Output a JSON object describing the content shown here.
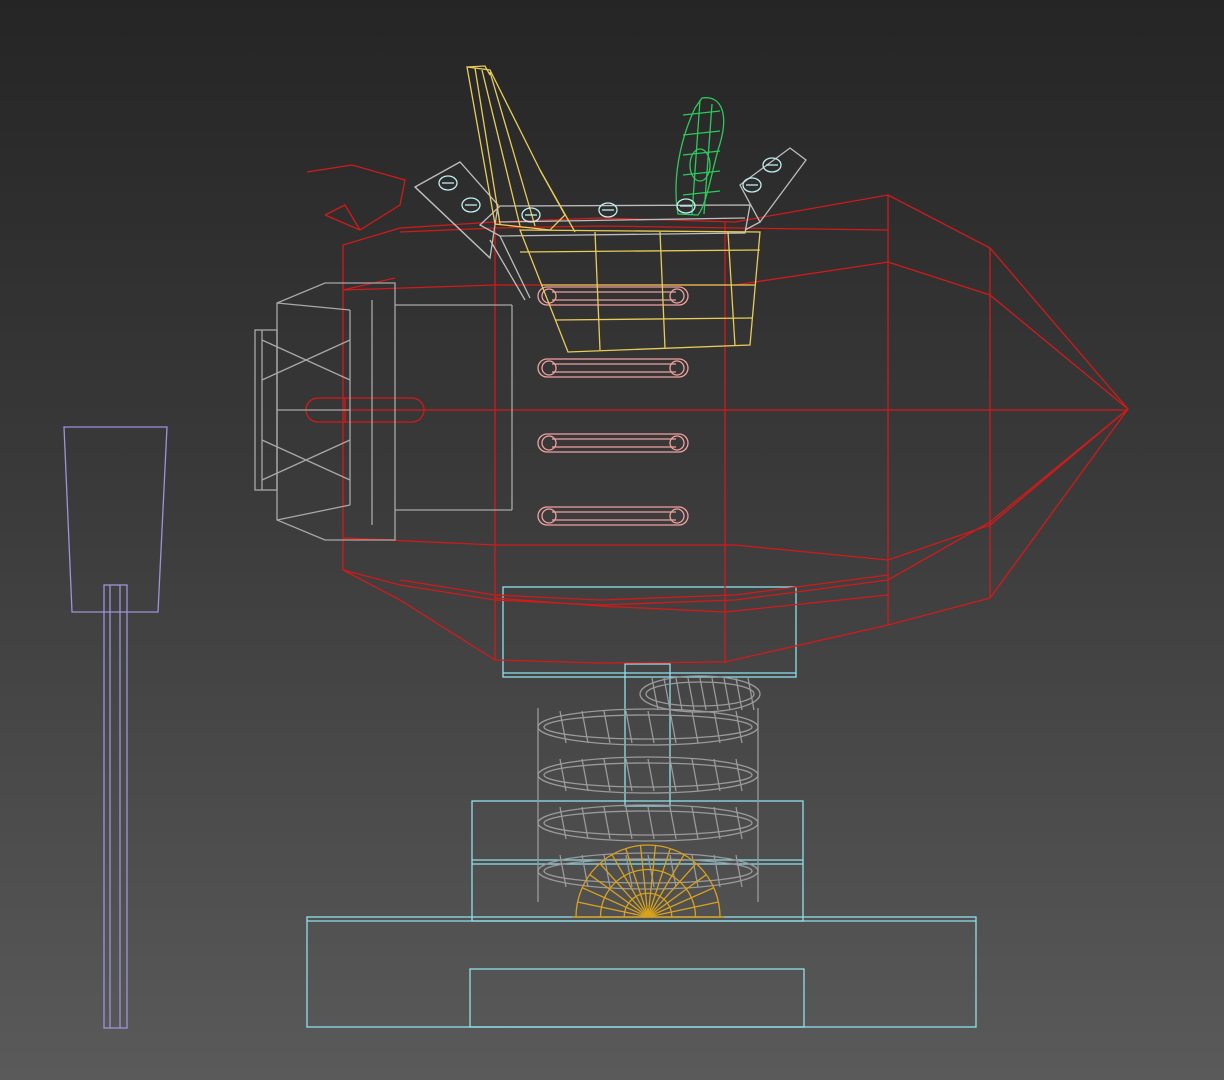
{
  "viewport": {
    "view": "front",
    "render_mode": "wireframe",
    "background": {
      "top": "#252525",
      "bottom": "#5a5a5a"
    }
  },
  "objects": [
    {
      "name": "rocket-body",
      "color": "#d21a1a"
    },
    {
      "name": "exhaust-nozzle",
      "color": "#a8a8a8"
    },
    {
      "name": "seat",
      "color": "#e8cc58"
    },
    {
      "name": "handle-grip",
      "color": "#2fc85a"
    },
    {
      "name": "footrest-brackets",
      "color": "#bdbdbd"
    },
    {
      "name": "bolt-heads",
      "color": "#bfeeee"
    },
    {
      "name": "side-rivets",
      "color": "#f0a0a0"
    },
    {
      "name": "spring",
      "color": "#9a9a9a"
    },
    {
      "name": "base-plates",
      "color": "#8fe0ec"
    },
    {
      "name": "half-dome-mount",
      "color": "#d8a21c"
    },
    {
      "name": "sign-post",
      "color": "#9c94d8"
    }
  ]
}
